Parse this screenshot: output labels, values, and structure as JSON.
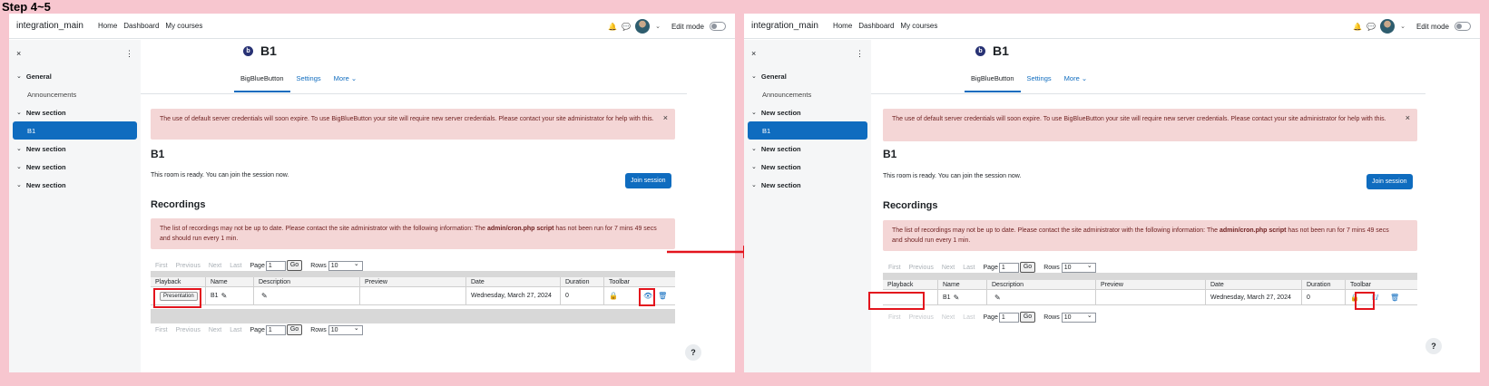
{
  "step_label": "Step 4~5",
  "navbar": {
    "brand": "integration_main",
    "links": [
      "Home",
      "Dashboard",
      "My courses"
    ],
    "edit_mode": "Edit mode"
  },
  "drawer": {
    "close": "×",
    "menu": "⋮",
    "items": [
      {
        "label": "General",
        "type": "section"
      },
      {
        "label": "Announcements",
        "type": "sub"
      },
      {
        "label": "New section",
        "type": "section"
      },
      {
        "label": "B1",
        "type": "active"
      },
      {
        "label": "New section",
        "type": "section"
      },
      {
        "label": "New section",
        "type": "section"
      },
      {
        "label": "New section",
        "type": "section"
      }
    ]
  },
  "page": {
    "title": "B1",
    "tabs": [
      "BigBlueButton",
      "Settings",
      "More ⌄"
    ],
    "alert_credentials": "The use of default server credentials will soon expire. To use BigBlueButton your site will require new server credentials. Please contact your site administrator for help with this.",
    "room_heading": "B1",
    "room_text": "This room is ready. You can join the session now.",
    "join_button": "Join session",
    "recordings_heading": "Recordings",
    "alert_cron_prefix": "The list of recordings may not be up to date. Please contact the site administrator with the following information: The ",
    "alert_cron_bold": "admin/cron.php script",
    "alert_cron_suffix": " has not been run for 7 mins 49 secs and should run every 1 min.",
    "alert_close": "×",
    "help": "?"
  },
  "pager": {
    "first": "First",
    "previous": "Previous",
    "next": "Next",
    "last": "Last",
    "page_label": "Page",
    "page_value": "1",
    "go": "Go",
    "rows_label": "Rows",
    "rows_value": "10"
  },
  "table": {
    "headers": [
      "Playback",
      "Name",
      "Description",
      "Preview",
      "Date",
      "Duration",
      "Toolbar"
    ],
    "row": {
      "playback": "Presentation",
      "name": "B1",
      "date": "Wednesday, March 27, 2024",
      "duration": "0"
    }
  },
  "colors": {
    "background": "#f7c6cf",
    "primary": "#0f6cbf",
    "alert_bg": "#f4d6d6",
    "highlight": "#e3141d"
  }
}
